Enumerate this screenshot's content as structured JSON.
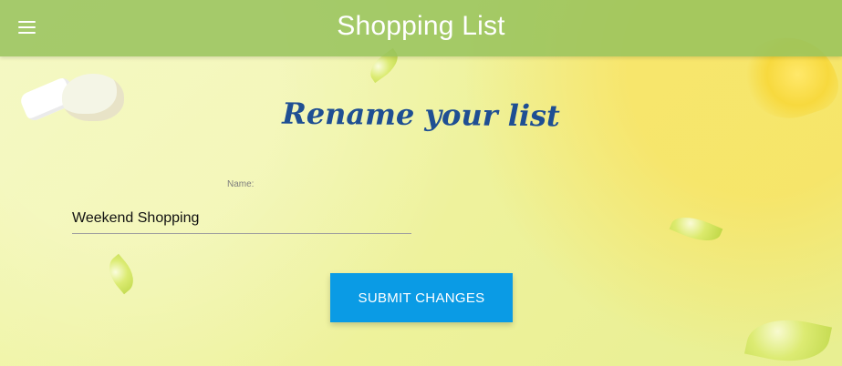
{
  "app": {
    "title": "Shopping List"
  },
  "icons": {
    "menu": "hamburger-menu"
  },
  "page": {
    "title": "Rename your list"
  },
  "form": {
    "name_label": "Name:",
    "name_value": "Weekend Shopping",
    "submit_label": "SUBMIT CHANGES"
  },
  "colors": {
    "appbar": "#97C25C",
    "page_title": "#1F4F93",
    "button": "#0A9BE5",
    "background": "#EEF59A"
  }
}
